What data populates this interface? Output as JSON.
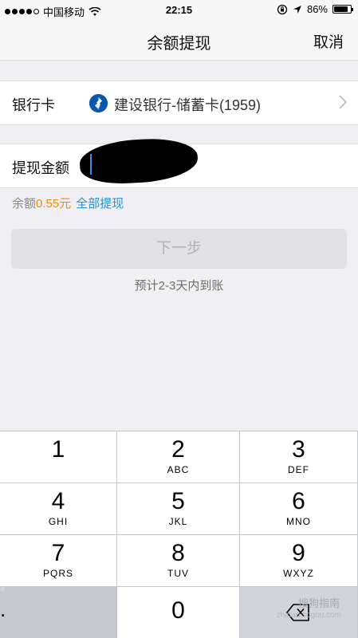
{
  "status_bar": {
    "carrier": "中国移动",
    "time": "22:15",
    "battery": "86%",
    "battery_level": 0.86
  },
  "navbar": {
    "title": "余额提现",
    "cancel_label": "取消"
  },
  "bank_row": {
    "label": "银行卡",
    "bank_name": "建设银行-储蓄卡(1959)"
  },
  "amount_row": {
    "label": "提现金额",
    "value": ""
  },
  "balance": {
    "label": "余额",
    "amount": "0.55元",
    "withdraw_all": "全部提现"
  },
  "next_button": "下一步",
  "eta": "预计2-3天内到账",
  "keypad": [
    {
      "num": "1",
      "letters": ""
    },
    {
      "num": "2",
      "letters": "ABC"
    },
    {
      "num": "3",
      "letters": "DEF"
    },
    {
      "num": "4",
      "letters": "GHI"
    },
    {
      "num": "5",
      "letters": "JKL"
    },
    {
      "num": "6",
      "letters": "MNO"
    },
    {
      "num": "7",
      "letters": "PQRS"
    },
    {
      "num": "8",
      "letters": "TUV"
    },
    {
      "num": "9",
      "letters": "WXYZ"
    },
    {
      "num": ".",
      "letters": ""
    },
    {
      "num": "0",
      "letters": ""
    }
  ],
  "watermark": {
    "text": "搜狗指南",
    "sub": "zhinan.sogou.com"
  },
  "colors": {
    "accent_blue": "#2a90d0",
    "balance_orange": "#f08c00",
    "bank_logo": "#0a58a8"
  }
}
